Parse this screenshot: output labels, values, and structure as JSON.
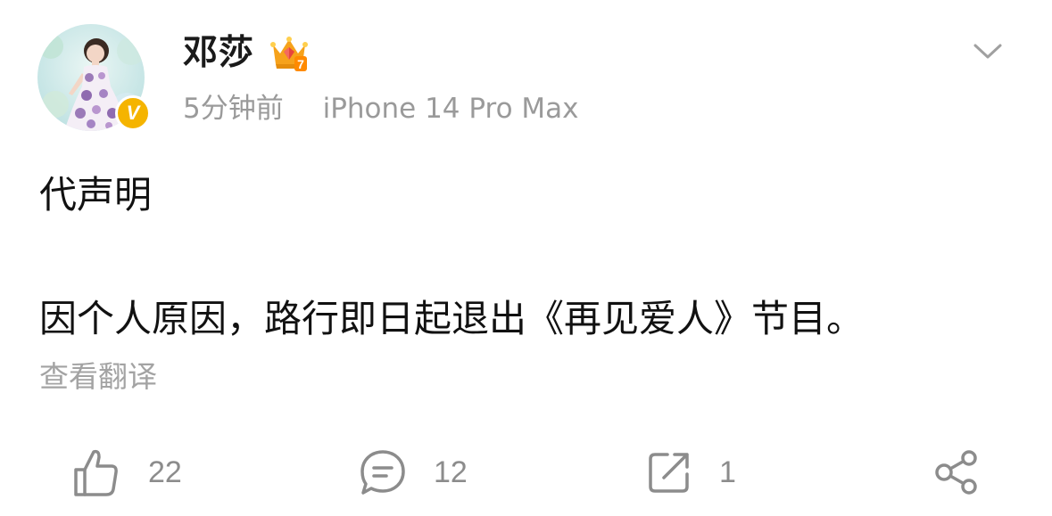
{
  "post": {
    "author": {
      "name": "邓莎",
      "vip_level": "7",
      "verified_mark": "V",
      "avatar_icon": "avatar-photo",
      "badge_color": "#f5b400"
    },
    "time": "5分钟前",
    "device": "iPhone 14 Pro Max",
    "content": {
      "line1": "代声明",
      "line2": "因个人原因，路行即日起退出《再见爱人》节目。"
    },
    "translate_label": "查看翻译"
  },
  "actions": {
    "likes": "22",
    "comments": "12",
    "reposts": "1"
  },
  "icons": {
    "menu": "chevron-down-icon",
    "like": "thumbs-up-icon",
    "comment": "comment-bubble-icon",
    "repost": "repost-icon",
    "share": "share-icon",
    "vip": "crown-icon"
  },
  "colors": {
    "secondary_text": "#9a9a9a",
    "icon_gray": "#8c8c8c",
    "crown": "#f6a21b"
  }
}
